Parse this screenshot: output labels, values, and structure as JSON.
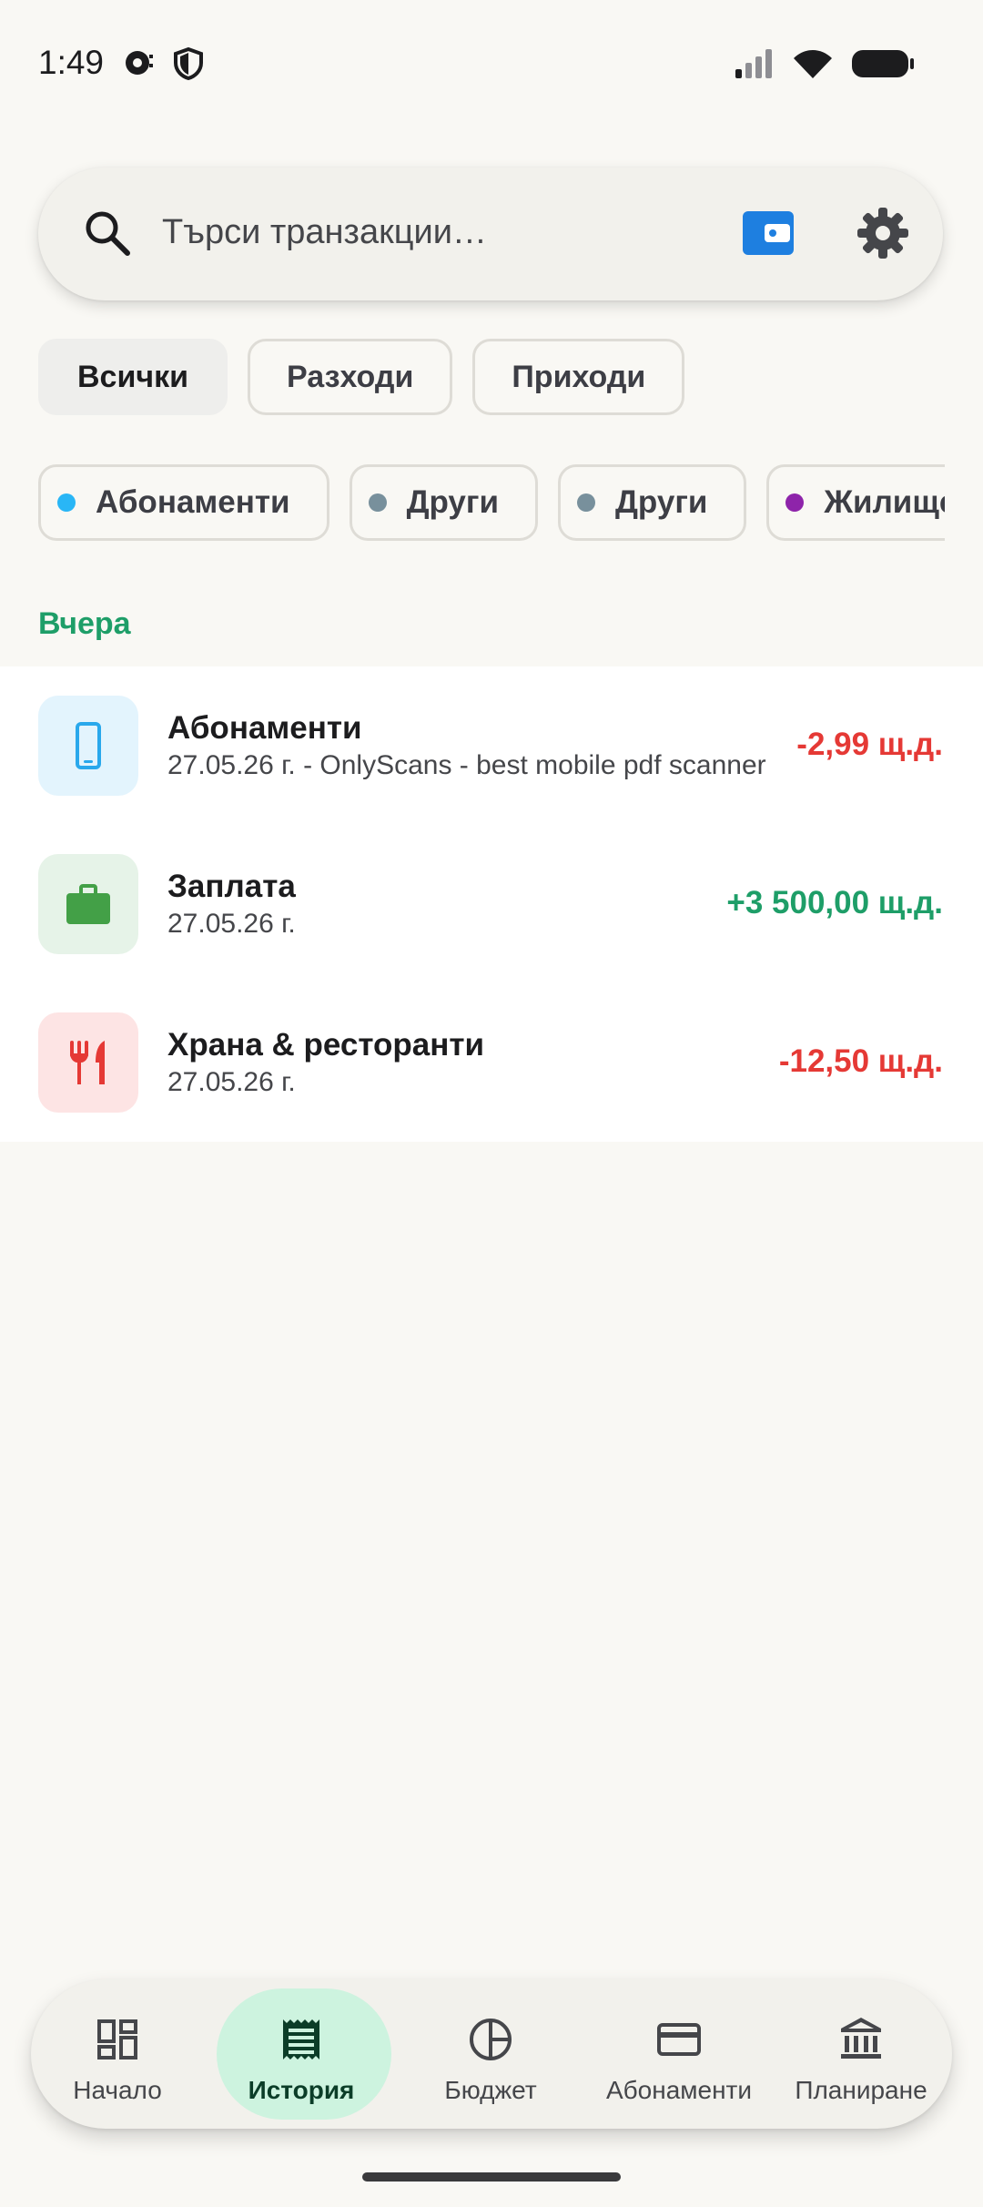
{
  "status_bar": {
    "time": "1:49"
  },
  "search": {
    "placeholder": "Търси транзакции…"
  },
  "type_filters": [
    {
      "label": "Всички",
      "selected": true
    },
    {
      "label": "Разходи",
      "selected": false
    },
    {
      "label": "Приходи",
      "selected": false
    }
  ],
  "category_filters": [
    {
      "label": "Абонаменти",
      "color": "#29b6f6"
    },
    {
      "label": "Други",
      "color": "#78909c"
    },
    {
      "label": "Други",
      "color": "#78909c"
    },
    {
      "label": "Жилище",
      "color": "#8e24aa"
    }
  ],
  "section": {
    "label": "Вчера"
  },
  "transactions": [
    {
      "title": "Абонаменти",
      "subtitle": "27.05.26 г. - OnlyScans - best mobile pdf scanner",
      "amount": "-2,99 щ.д.",
      "amount_color": "#e53935",
      "icon": "smartphone-icon",
      "icon_bg": "#e3f4fd",
      "icon_color": "#29a8ec"
    },
    {
      "title": "Заплата",
      "subtitle": "27.05.26 г.",
      "amount": "+3 500,00 щ.д.",
      "amount_color": "#1e9e68",
      "icon": "briefcase-icon",
      "icon_bg": "#e6f3e8",
      "icon_color": "#43a047"
    },
    {
      "title": "Храна & ресторанти",
      "subtitle": "27.05.26 г.",
      "amount": "-12,50 щ.д.",
      "amount_color": "#e53935",
      "icon": "restaurant-icon",
      "icon_bg": "#fde4e4",
      "icon_color": "#e53935"
    }
  ],
  "nav": {
    "items": [
      {
        "label": "Начало",
        "icon": "dashboard-icon",
        "active": false
      },
      {
        "label": "История",
        "icon": "receipt-icon",
        "active": true
      },
      {
        "label": "Бюджет",
        "icon": "pie-chart-icon",
        "active": false
      },
      {
        "label": "Абонаменти",
        "icon": "credit-card-icon",
        "active": false
      },
      {
        "label": "Планиране",
        "icon": "bank-icon",
        "active": false
      }
    ]
  },
  "colors": {
    "accent": "#1e9e68",
    "expense": "#e53935",
    "income": "#1e9e68",
    "wallet": "#1e7fe0"
  }
}
